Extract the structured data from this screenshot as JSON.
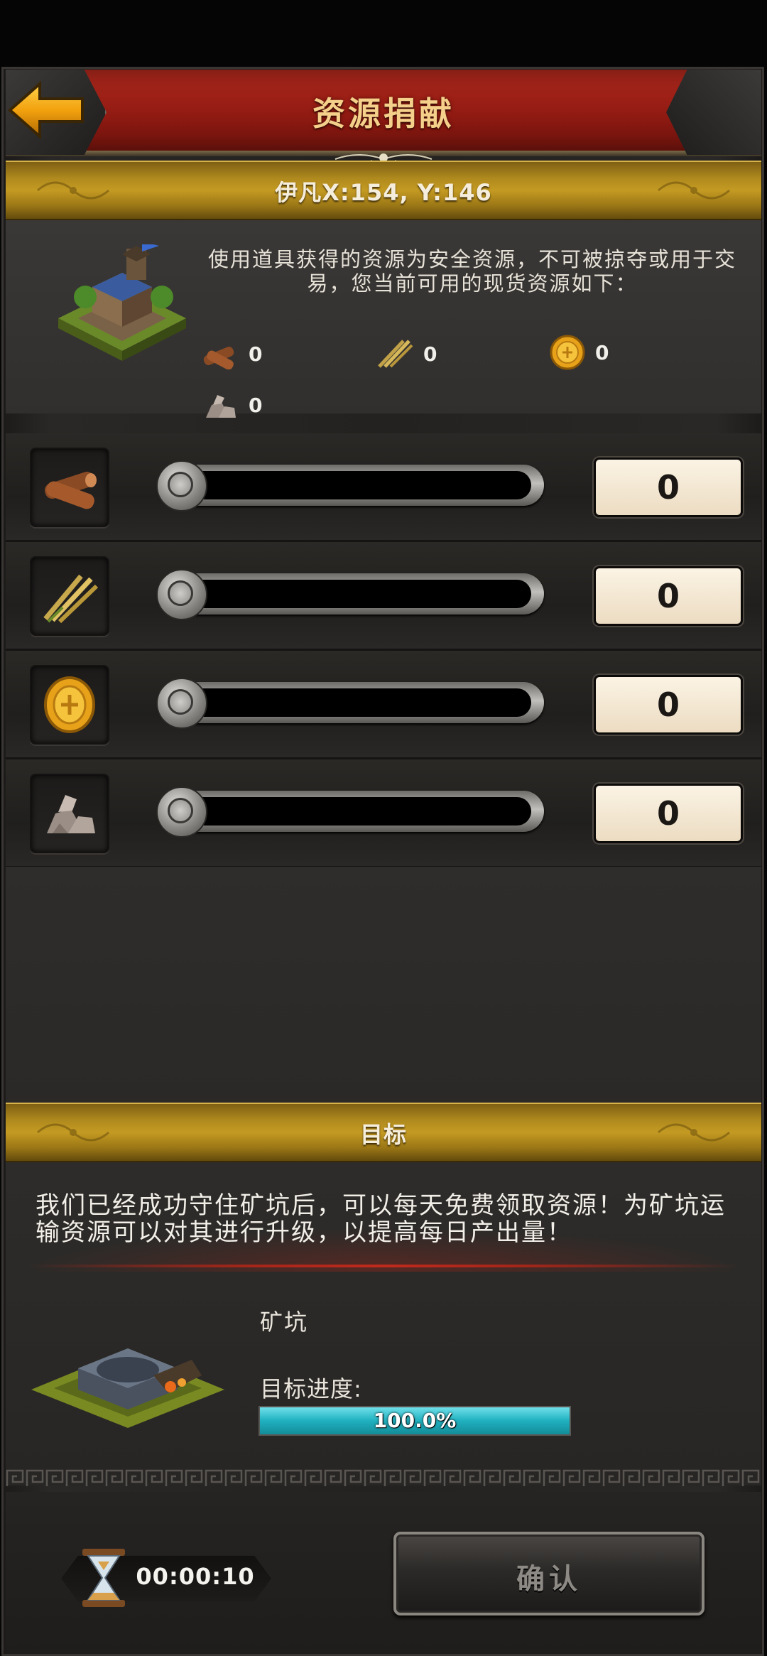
{
  "header": {
    "title": "资源捐献"
  },
  "location_banner": {
    "text": "伊凡X:154, Y:146"
  },
  "info": {
    "text": "使用道具获得的资源为安全资源，不可被掠夺或用于交易，您当前可用的现货资源如下：",
    "available": [
      {
        "icon": "wood-icon",
        "value": "0"
      },
      {
        "icon": "wheat-icon",
        "value": "0"
      },
      {
        "icon": "gold-coin-icon",
        "value": "0"
      },
      {
        "icon": "stone-icon",
        "value": "0"
      }
    ]
  },
  "resource_rows": [
    {
      "icon": "wood-icon",
      "amount": "0",
      "slider_level": 0
    },
    {
      "icon": "wheat-icon",
      "amount": "0",
      "slider_level": 0
    },
    {
      "icon": "gold-coin-icon",
      "amount": "0",
      "slider_level": 0
    },
    {
      "icon": "stone-icon",
      "amount": "0",
      "slider_level": 0
    }
  ],
  "goal": {
    "banner": "目标",
    "description": "我们已经成功守住矿坑后，可以每天免费领取资源！为矿坑运输资源可以对其进行升级，以提高每日产出量！",
    "target_name": "矿坑",
    "progress_label": "目标进度:",
    "progress_text": "100.0%",
    "progress_fraction": 1.0
  },
  "footer": {
    "timer": "00:00:10",
    "confirm_label": "确认"
  },
  "colors": {
    "header_red": "#9a1e14",
    "banner_gold": "#c49a22",
    "progress_teal": "#1fb0bf",
    "title_gold": "#f4d08a"
  }
}
